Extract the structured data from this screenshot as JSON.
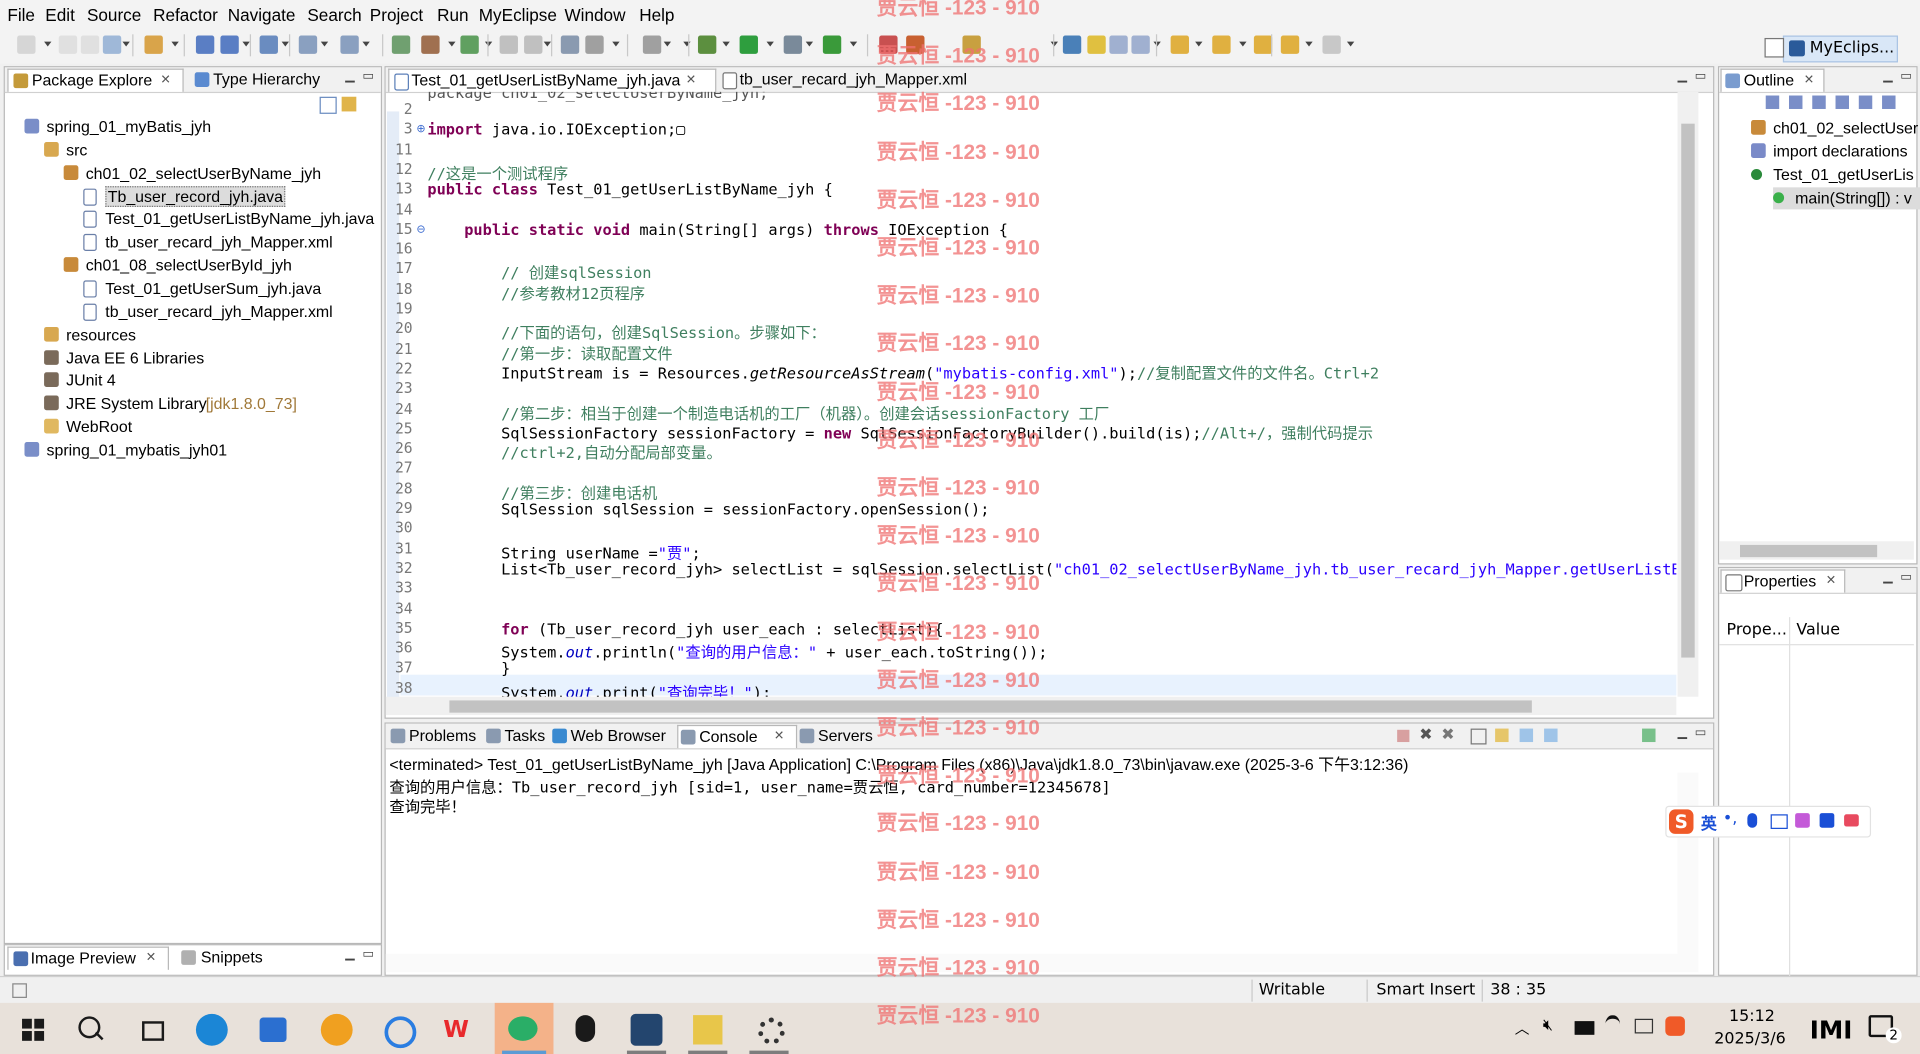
{
  "menu": [
    "File",
    "Edit",
    "Source",
    "Refactor",
    "Navigate",
    "Search",
    "Project",
    "Run",
    "MyEclipse",
    "Window",
    "Help"
  ],
  "perspective": {
    "label": "MyEclips..."
  },
  "watermark": "贾云恒 -123 - 910",
  "left_panel": {
    "tabs": [
      "Package Explore",
      "Type Hierarchy"
    ],
    "tree": [
      {
        "label": "spring_01_myBatis_jyh",
        "indent": 0,
        "icon": "project-icon"
      },
      {
        "label": "src",
        "indent": 1,
        "icon": "source-folder-icon"
      },
      {
        "label": "ch01_02_selectUserByName_jyh",
        "indent": 2,
        "icon": "package-icon"
      },
      {
        "label": "Tb_user_record_jyh.java",
        "indent": 3,
        "icon": "java-file-icon",
        "selected": true
      },
      {
        "label": "Test_01_getUserListByName_jyh.java",
        "indent": 3,
        "icon": "java-file-icon"
      },
      {
        "label": "tb_user_recard_jyh_Mapper.xml",
        "indent": 3,
        "icon": "xml-file-icon"
      },
      {
        "label": "ch01_08_selectUserById_jyh",
        "indent": 2,
        "icon": "package-icon"
      },
      {
        "label": "Test_01_getUserSum_jyh.java",
        "indent": 3,
        "icon": "java-file-icon"
      },
      {
        "label": "tb_user_recard_jyh_Mapper.xml",
        "indent": 3,
        "icon": "xml-file-icon"
      },
      {
        "label": "resources",
        "indent": 1,
        "icon": "source-folder-icon"
      },
      {
        "label": "Java EE 6 Libraries",
        "indent": 1,
        "icon": "library-icon"
      },
      {
        "label": "JUnit 4",
        "indent": 1,
        "icon": "library-icon"
      },
      {
        "label": "JRE System Library",
        "extra": "[jdk1.8.0_73]",
        "indent": 1,
        "icon": "library-icon"
      },
      {
        "label": "WebRoot",
        "indent": 1,
        "icon": "folder-icon"
      },
      {
        "label": "spring_01_mybatis_jyh01",
        "indent": 0,
        "icon": "project-icon"
      }
    ],
    "bottom_tabs": [
      "Image Preview",
      "Snippets"
    ]
  },
  "editor": {
    "tabs": [
      "Test_01_getUserListByName_jyh.java",
      "tb_user_recard_jyh_Mapper.xml"
    ],
    "top_partial": "package ch01_02_selectUserByName_jyh;",
    "lines": [
      {
        "n": "2",
        "html": ""
      },
      {
        "n": "3",
        "html": "<span class='kw'>import</span> java.io.IOException;▢"
      },
      {
        "n": "11",
        "html": ""
      },
      {
        "n": "12",
        "html": "<span class='cm'>//这是一个测试程序</span>"
      },
      {
        "n": "13",
        "html": "<span class='kw'>public class</span> Test_01_getUserListByName_jyh {"
      },
      {
        "n": "14",
        "html": ""
      },
      {
        "n": "15",
        "html": "    <span class='kw'>public static void</span> main(String[] args) <span class='kw'>throws</span> IOException {"
      },
      {
        "n": "16",
        "html": ""
      },
      {
        "n": "17",
        "html": "        <span class='cm'>// 创建sqlSession</span>"
      },
      {
        "n": "18",
        "html": "        <span class='cm'>//参考教材12页程序</span>"
      },
      {
        "n": "19",
        "html": ""
      },
      {
        "n": "20",
        "html": "        <span class='cm'>//下面的语句，创建SqlSession。步骤如下：</span>"
      },
      {
        "n": "21",
        "html": "        <span class='cm'>//第一步：读取配置文件</span>"
      },
      {
        "n": "22",
        "html": "        InputStream is = Resources.<span class='it'>getResourceAsStream</span>(<span class='st'>\"mybatis-config.xml\"</span>);<span class='cm'>//复制配置文件的文件名。Ctrl+2</span>"
      },
      {
        "n": "23",
        "html": ""
      },
      {
        "n": "24",
        "html": "        <span class='cm'>//第二步：相当于创建一个制造电话机的工厂（机器）。创建会话sessionFactory 工厂</span>"
      },
      {
        "n": "25",
        "html": "        SqlSessionFactory sessionFactory = <span class='kw'>new</span> SqlSessionFactoryBuilder().build(is);<span class='cm'>//Alt+/，强制代码提示</span>"
      },
      {
        "n": "26",
        "html": "        <span class='cm'>//ctrl+2,自动分配局部变量。</span>"
      },
      {
        "n": "27",
        "html": ""
      },
      {
        "n": "28",
        "html": "        <span class='cm'>//第三步：创建电话机</span>"
      },
      {
        "n": "29",
        "html": "        SqlSession sqlSession = sessionFactory.openSession();"
      },
      {
        "n": "30",
        "html": ""
      },
      {
        "n": "31",
        "html": "        String userName =<span class='st'>\"贾\"</span>;"
      },
      {
        "n": "32",
        "html": "        List&lt;Tb_user_record_jyh&gt; selectList = sqlSession.selectList(<span class='st'>\"ch01_02_selectUserByName_jyh.tb_user_recard_jyh_Mapper.getUserListByNa</span>"
      },
      {
        "n": "33",
        "html": ""
      },
      {
        "n": "34",
        "html": ""
      },
      {
        "n": "35",
        "html": "        <span class='kw'>for</span> (Tb_user_record_jyh user_each : selectList){"
      },
      {
        "n": "36",
        "html": "        System.<span class='fld'>out</span>.println(<span class='st'>\"查询的用户信息：\"</span> + user_each.toString());"
      },
      {
        "n": "37",
        "html": "        }"
      },
      {
        "n": "38",
        "html": "        System.<span class='fld'>out</span>.print(<span class='st'>\"查询完毕！\"</span>);"
      }
    ]
  },
  "outline": {
    "tab": "Outline",
    "items": [
      {
        "label": "ch01_02_selectUser",
        "indent": 0,
        "icon": "package-icon"
      },
      {
        "label": "import declarations",
        "indent": 0,
        "icon": "import-icon"
      },
      {
        "label": "Test_01_getUserLis",
        "indent": 0,
        "icon": "class-icon"
      },
      {
        "label": "main(String[]) : v",
        "indent": 1,
        "icon": "method-icon",
        "selected": true
      }
    ]
  },
  "properties": {
    "tab": "Properties",
    "col1": "Prope...",
    "col2": "Value"
  },
  "console": {
    "tabs": [
      "Problems",
      "Tasks",
      "Web Browser",
      "Console",
      "Servers"
    ],
    "header": "<terminated> Test_01_getUserListByName_jyh [Java Application] C:\\Program Files (x86)\\Java\\jdk1.8.0_73\\bin\\javaw.exe (2025-3-6 下午3:12:36)",
    "output": [
      "查询的用户信息：Tb_user_record_jyh [sid=1, user_name=贾云恒, card_number=12345678]",
      "查询完毕！"
    ]
  },
  "ime": {
    "label": "英"
  },
  "status": {
    "writable": "Writable",
    "insert": "Smart Insert",
    "position": "38 : 35"
  },
  "taskbar": {
    "time": "15:12",
    "date": "2025/3/6",
    "notification_count": "2"
  }
}
